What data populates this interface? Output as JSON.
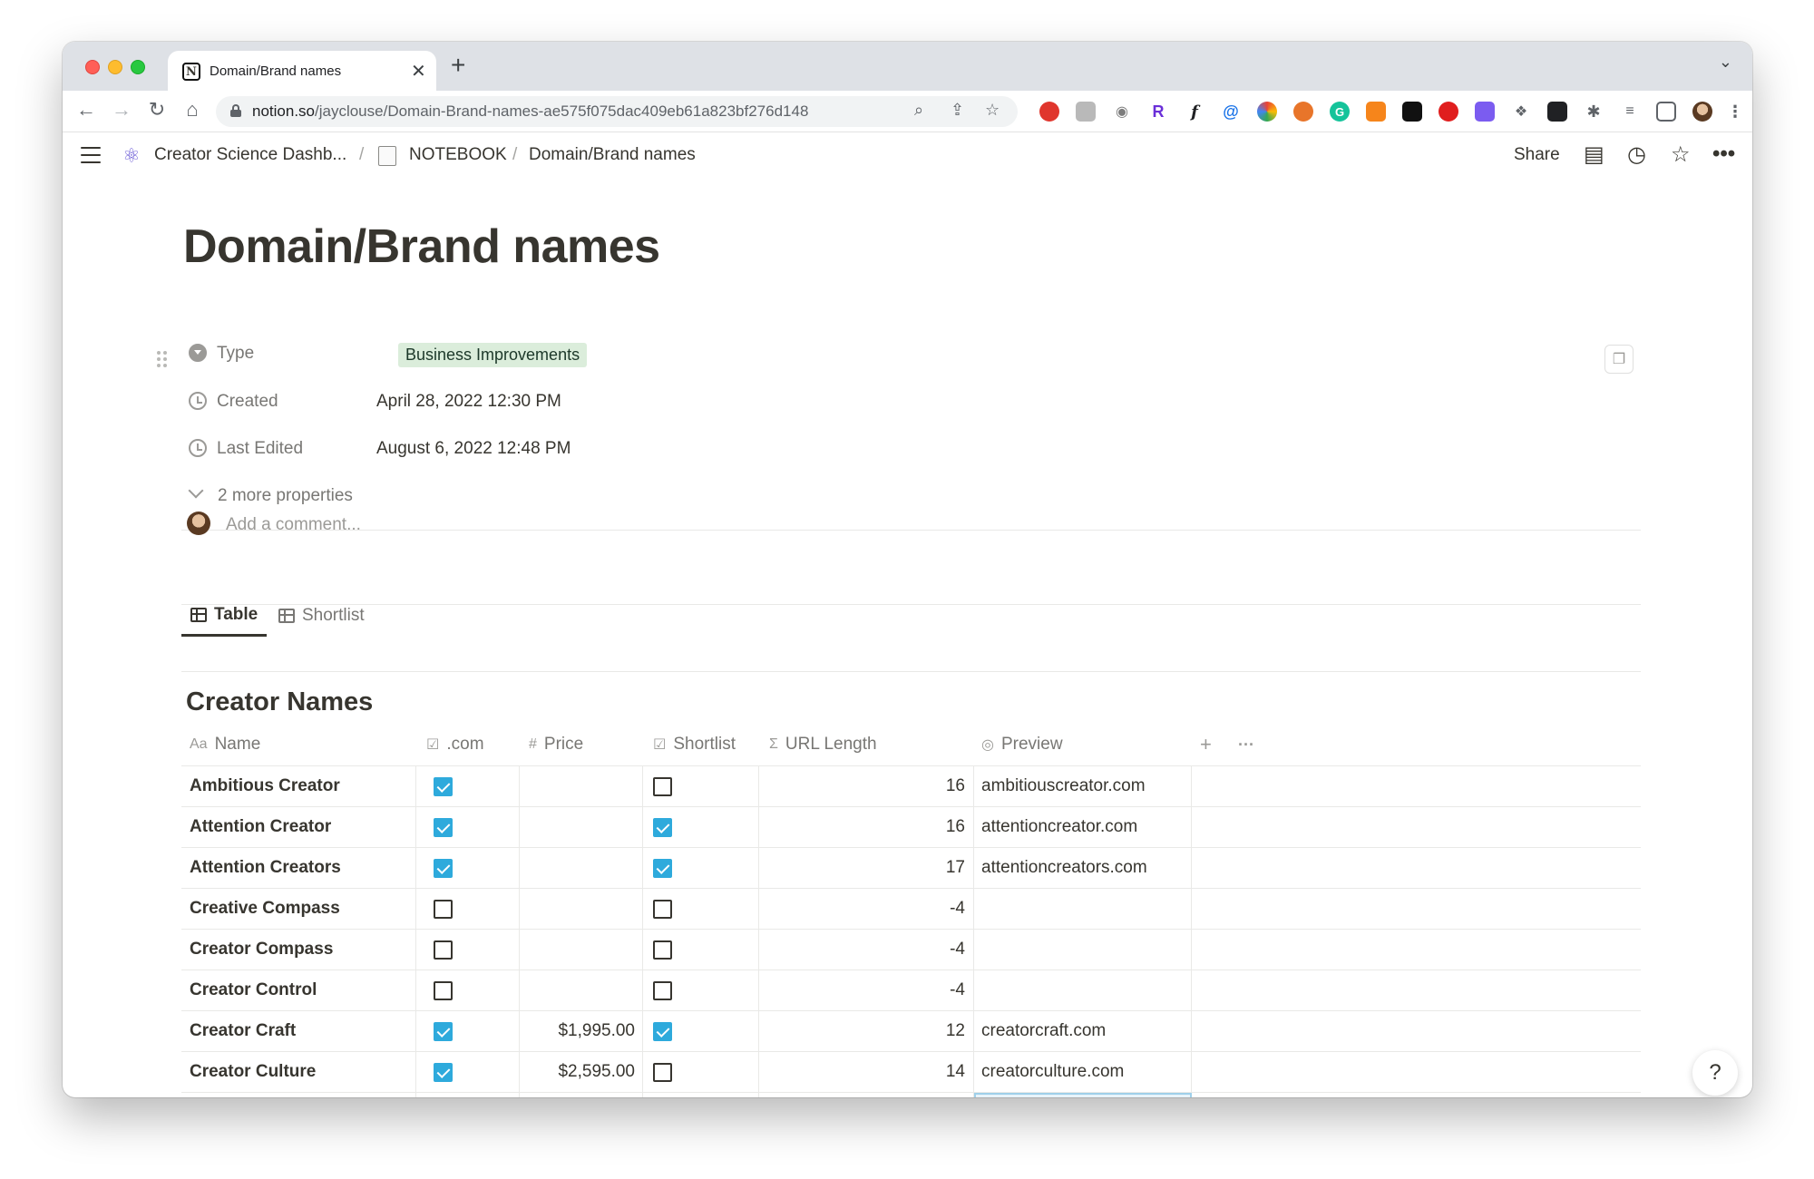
{
  "browser": {
    "tab_title": "Domain/Brand names",
    "url_host": "notion.so",
    "url_path": "/jayclouse/Domain-Brand-names-ae575f075dac409eb61a823bf276d148"
  },
  "breadcrumb": {
    "workspace": "Creator Science Dashb...",
    "notebook": "NOTEBOOK",
    "page": "Domain/Brand names",
    "separator": "/"
  },
  "topbar": {
    "share_label": "Share"
  },
  "page": {
    "title": "Domain/Brand names",
    "properties": [
      {
        "label": "Type",
        "value": "Business Improvements"
      },
      {
        "label": "Created",
        "value": "April 28, 2022 12:30 PM"
      },
      {
        "label": "Last Edited",
        "value": "August 6, 2022 12:48 PM"
      }
    ],
    "more_properties": "2 more properties",
    "comment_placeholder": "Add a comment..."
  },
  "views": [
    {
      "label": "Table",
      "active": true
    },
    {
      "label": "Shortlist",
      "active": false
    }
  ],
  "database": {
    "title": "Creator Names",
    "columns": {
      "name": {
        "label": "Name",
        "icon": "Aa"
      },
      "com": {
        "label": ".com",
        "icon": "☑"
      },
      "price": {
        "label": "Price",
        "icon": "#"
      },
      "shortlist": {
        "label": "Shortlist",
        "icon": "☑"
      },
      "url_length": {
        "label": "URL Length",
        "icon": "Σ"
      },
      "preview": {
        "label": "Preview",
        "icon": "◎"
      }
    },
    "rows": [
      {
        "name": "Ambitious Creator",
        "com": true,
        "price": "",
        "shortlist": false,
        "url_length": "16",
        "preview": "ambitiouscreator.com"
      },
      {
        "name": "Attention Creator",
        "com": true,
        "price": "",
        "shortlist": true,
        "url_length": "16",
        "preview": "attentioncreator.com"
      },
      {
        "name": "Attention Creators",
        "com": true,
        "price": "",
        "shortlist": true,
        "url_length": "17",
        "preview": "attentioncreators.com"
      },
      {
        "name": "Creative Compass",
        "com": false,
        "price": "",
        "shortlist": false,
        "url_length": "-4",
        "preview": ""
      },
      {
        "name": "Creator Compass",
        "com": false,
        "price": "",
        "shortlist": false,
        "url_length": "-4",
        "preview": ""
      },
      {
        "name": "Creator Control",
        "com": false,
        "price": "",
        "shortlist": false,
        "url_length": "-4",
        "preview": ""
      },
      {
        "name": "Creator Craft",
        "com": true,
        "price": "$1,995.00",
        "shortlist": true,
        "url_length": "12",
        "preview": "creatorcraft.com"
      },
      {
        "name": "Creator Culture",
        "com": true,
        "price": "$2,595.00",
        "shortlist": false,
        "url_length": "14",
        "preview": "creatorculture.com"
      }
    ]
  },
  "colors": {
    "accent_checkbox": "#2eaadc",
    "tag_bg": "#dbeddb",
    "text": "#37352f",
    "muted": "#787774"
  },
  "help_label": "?"
}
